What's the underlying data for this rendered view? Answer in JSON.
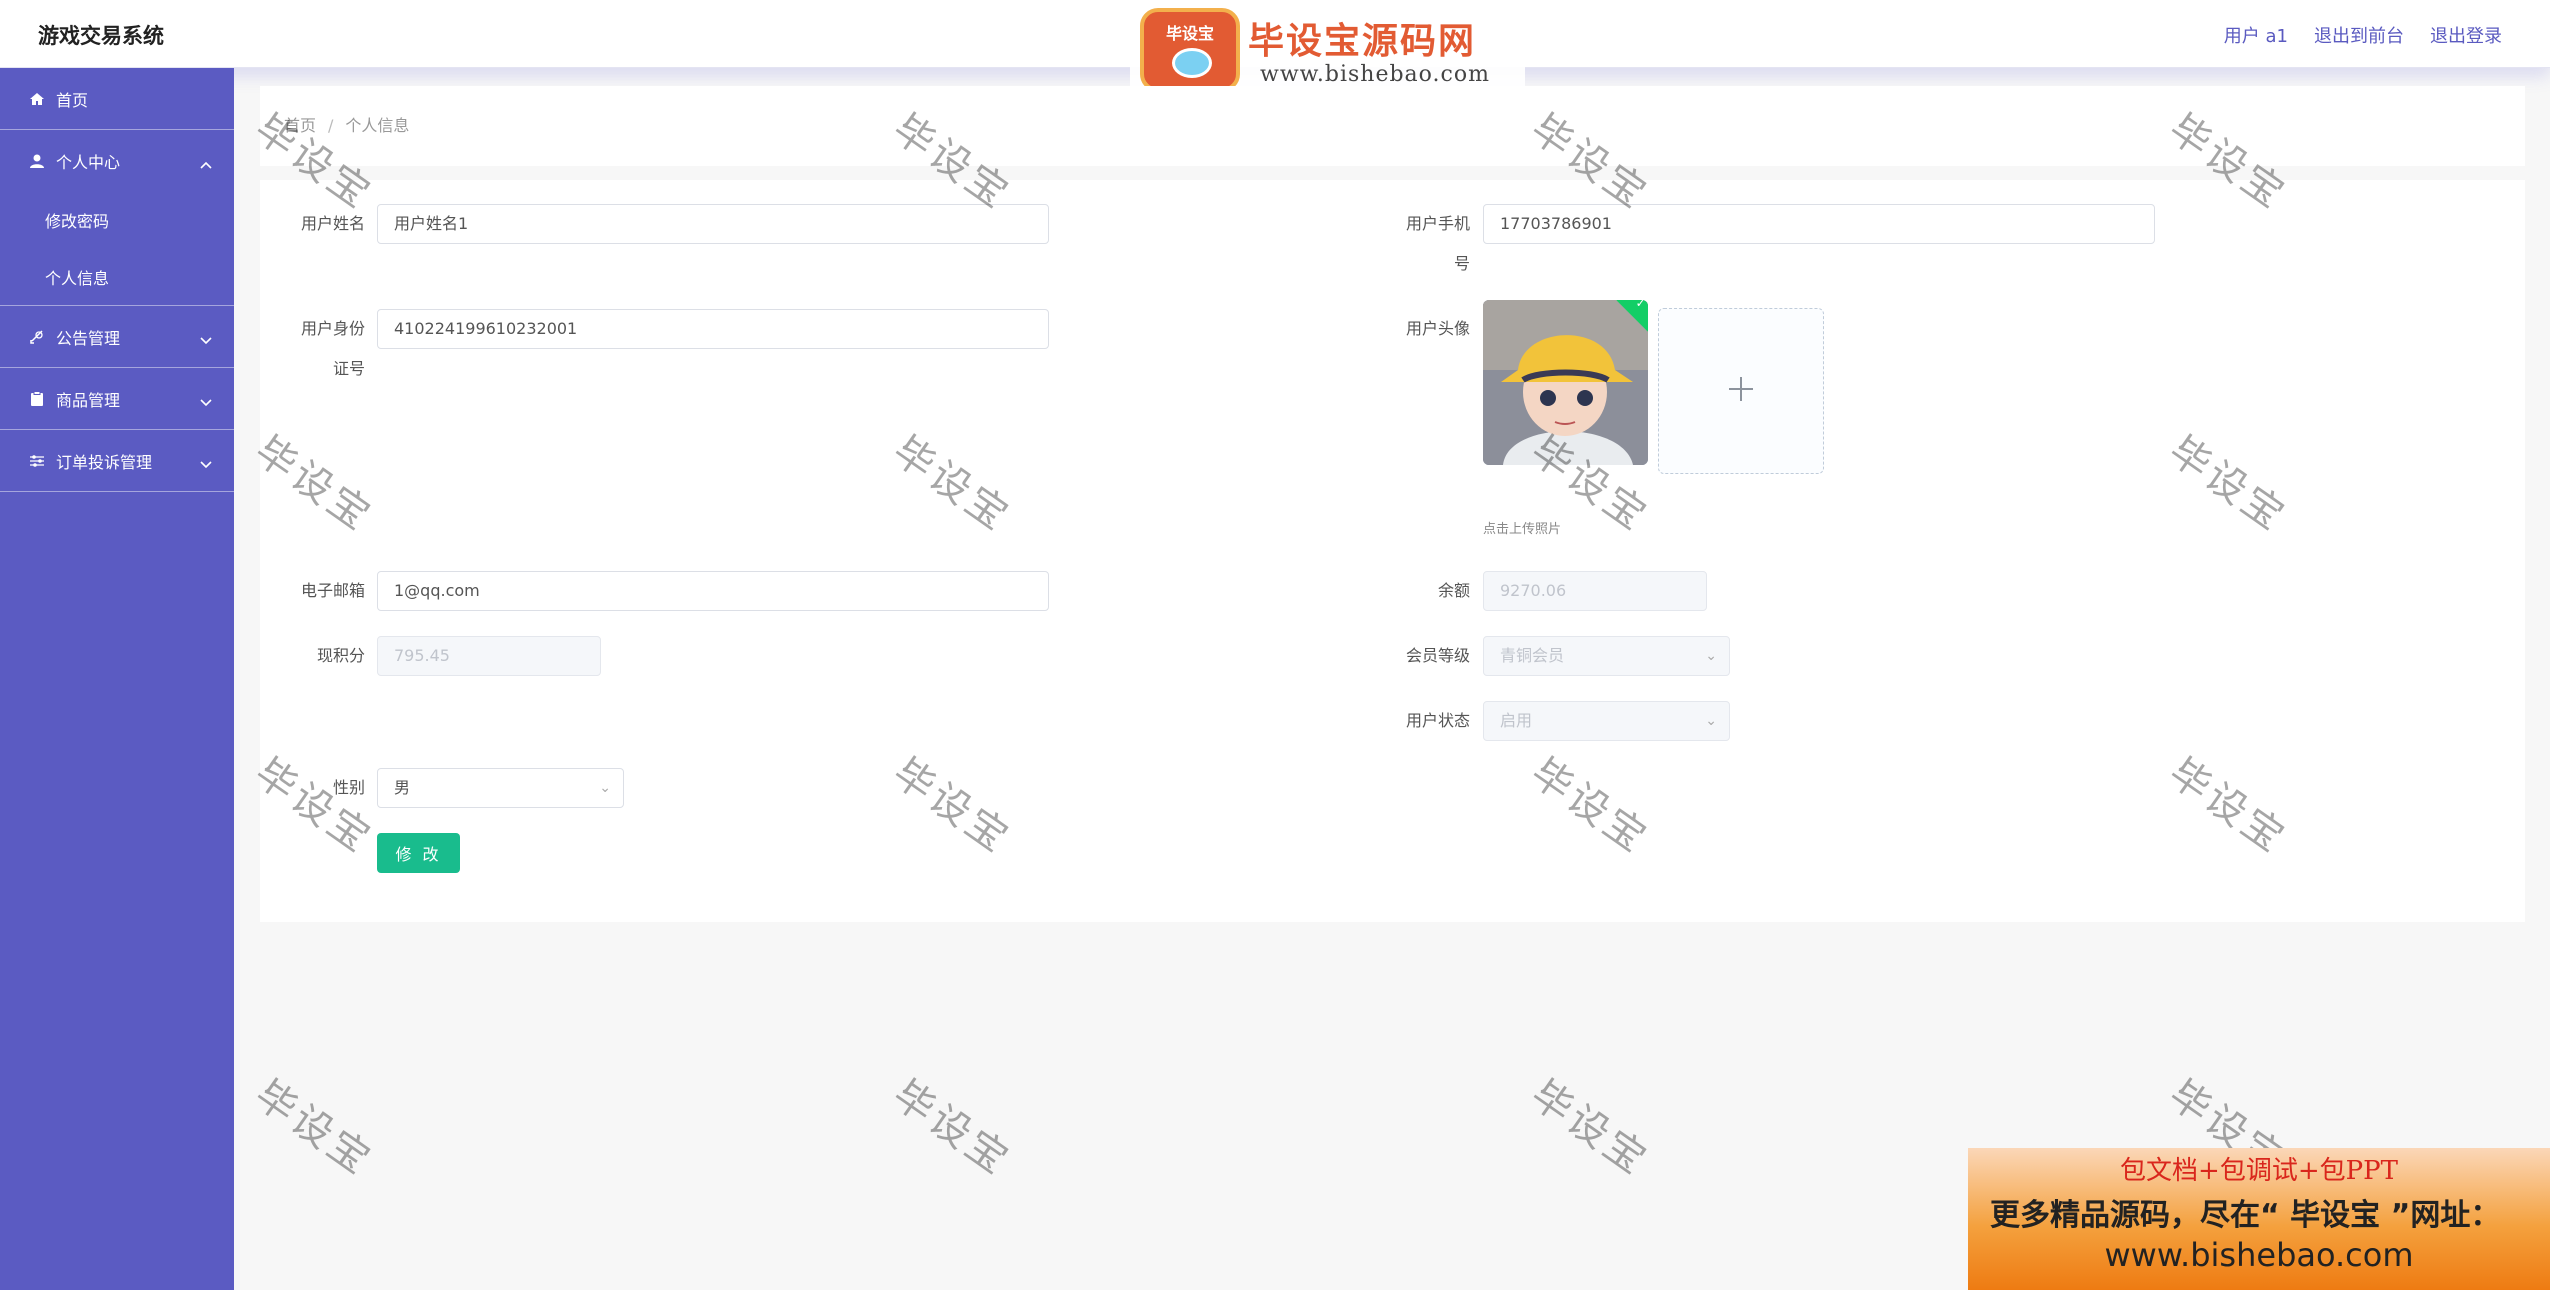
{
  "header": {
    "title": "游戏交易系统",
    "user": "用户 a1",
    "to_front": "退出到前台",
    "logout": "退出登录"
  },
  "logo_watermark": {
    "badge_text": "毕设宝",
    "title": "毕设宝源码网",
    "url": "www.bishebao.com"
  },
  "sidebar": {
    "home": "首页",
    "personal_center": "个人中心",
    "change_password": "修改密码",
    "personal_info": "个人信息",
    "announcement": "公告管理",
    "product": "商品管理",
    "order_complaint": "订单投诉管理"
  },
  "breadcrumb": {
    "home": "首页",
    "sep": "/",
    "current": "个人信息"
  },
  "form": {
    "username_label": "用户姓名",
    "username_value": "用户姓名1",
    "phone_label": "用户手机号",
    "phone_value": "17703786901",
    "idcard_label": "用户身份证号",
    "idcard_value": "410224199610232001",
    "avatar_label": "用户头像",
    "upload_hint": "点击上传照片",
    "email_label": "电子邮箱",
    "email_value": "1@qq.com",
    "balance_label": "余额",
    "balance_value": "9270.06",
    "points_label": "现积分",
    "points_value": "795.45",
    "level_label": "会员等级",
    "level_value": "青铜会员",
    "status_label": "用户状态",
    "status_value": "启用",
    "gender_label": "性别",
    "gender_value": "男",
    "submit_label": "修 改"
  },
  "watermark_text": "毕设宝",
  "ad": {
    "line1": "包文档+包调试+包PPT",
    "line2": "更多精品源码，尽在“ 毕设宝 ”网址：",
    "line3": "www.bishebao.com"
  },
  "colors": {
    "sidebar": "#5b5bc2",
    "primary_text": "#5a5ac0",
    "button": "#19bc8d"
  }
}
